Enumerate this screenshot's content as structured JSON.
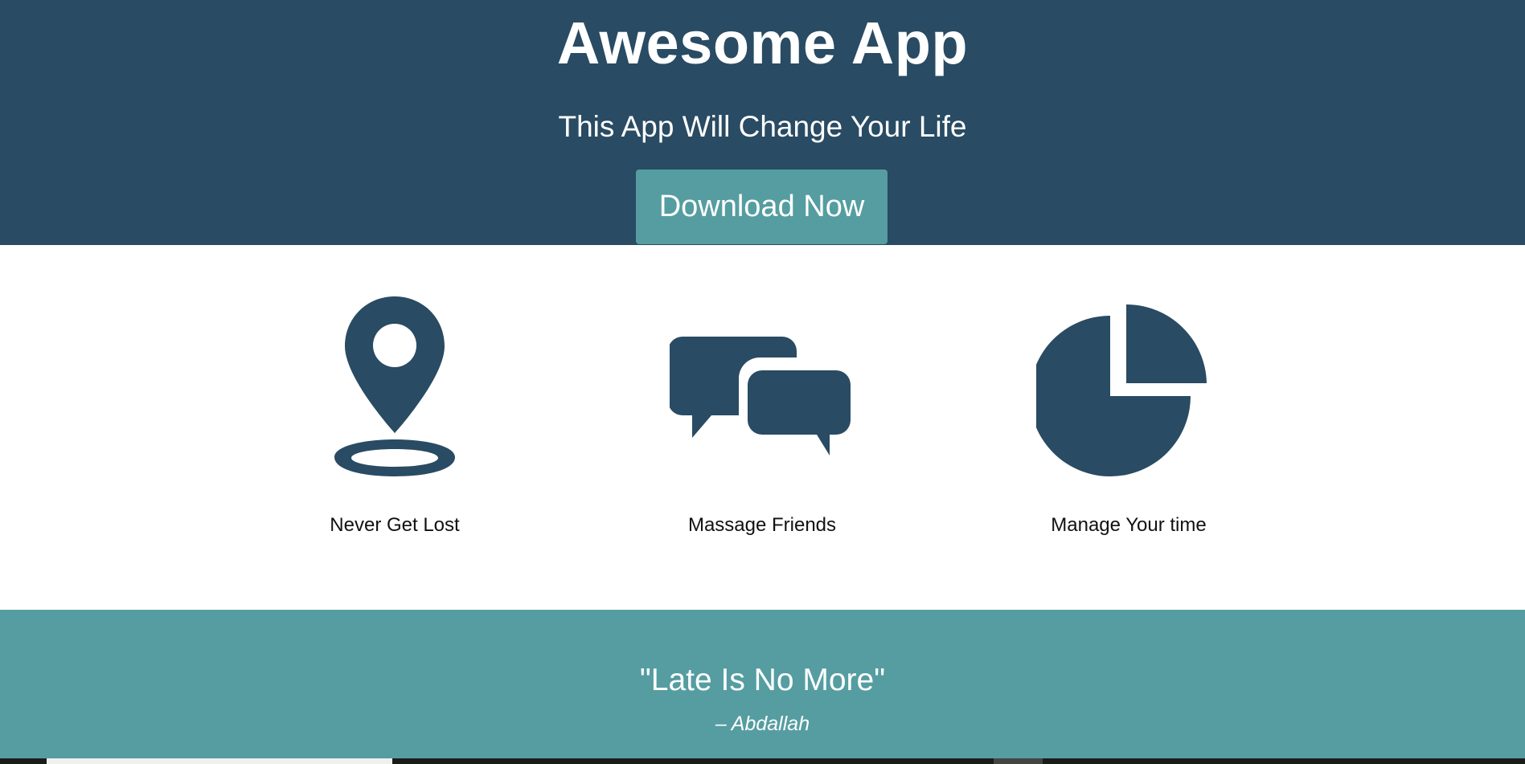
{
  "hero": {
    "title": "Awesome App",
    "subtitle": "This App Will Change Your Life",
    "download_label": "Download Now"
  },
  "features": [
    {
      "label": "Never Get Lost",
      "icon": "map-pin-icon"
    },
    {
      "label": "Massage Friends",
      "icon": "chat-bubbles-icon"
    },
    {
      "label": "Manage Your time",
      "icon": "pie-chart-icon"
    }
  ],
  "testimonial": {
    "quote": "\"Late Is No More\"",
    "author": "– Abdallah"
  },
  "colors": {
    "hero_bg": "#294b63",
    "accent": "#559da1",
    "icon": "#294b63",
    "text_light": "#ffffff",
    "text_dark": "#111111"
  }
}
